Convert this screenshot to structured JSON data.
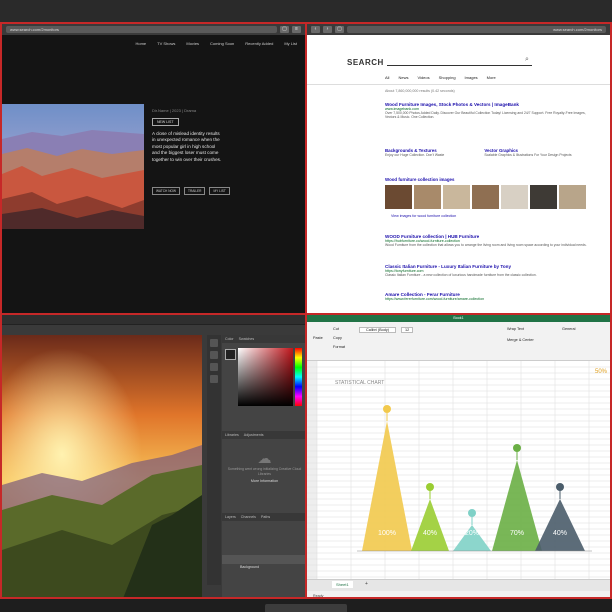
{
  "tl": {
    "url": "www.search.com/2monitors",
    "nav": [
      "Home",
      "TV Shows",
      "Movies",
      "Coming Soon",
      "Recently Added",
      "My List"
    ],
    "meta": "Dir.Name   |   2023   |   Drama",
    "tag": "NEW LIST",
    "text": "A close of mislead identity results in unexpected romance when the most popular girl in high school and the biggest loser must come together to win over their crushes.",
    "buttons": [
      "WATCH NOW",
      "TRAILER",
      "MY LIST"
    ]
  },
  "tr": {
    "url": "www.search.com/2monitors",
    "logo": "SEARCH",
    "tabs": [
      "All",
      "News",
      "Videos",
      "Shopping",
      "Images",
      "More"
    ],
    "count": "About 7,860,000,000 results (0.42 seconds)",
    "results": [
      {
        "title": "Wood Furniture Images, Stock Photos & Vectors | ImageBank",
        "url": "www.imagebank.com",
        "desc": "Over 7,500,000 Photos Added Daily. Discover Our Beautiful Collection Today! Licensing and 24/7 Support. Free Royalty-Free Images, Vectors & Music. One Collection."
      },
      {
        "title": "Wood furniture collection images",
        "url": "",
        "desc": ""
      },
      {
        "title": "WOOD Furniture collection | HUB Furniture",
        "url": "https://hubfurniture.co/wood-furniture-collection",
        "desc": "Wood Furniture from the collection that allows you to arrange the living room and living room space according to your individual needs."
      },
      {
        "title": "Classic Italian Furniture - Luxury Italian Furniture by Tony",
        "url": "https://tonyfurniture.com",
        "desc": "Classic Italian Furniture - a new collection of luxurious handmade furniture from the classic collection."
      },
      {
        "title": "Amare Collection - Ferar Furniture",
        "url": "https://www.fererfurniture.com/wood-furniture/amare-collection",
        "desc": ""
      }
    ],
    "cols": [
      {
        "title": "Backgrounds & Textures",
        "desc": "Enjoy our Huge Collection. Don't Waste"
      },
      {
        "title": "Vector Graphics",
        "desc": "Scalable Graphics & Illustrations For Your Design Projects"
      }
    ],
    "more": "View images for wood furniture collection"
  },
  "bl": {
    "panel_tabs": [
      "Color",
      "Swatches"
    ],
    "lib_tabs": [
      "Libraries",
      "Adjustments"
    ],
    "cloud_msg": "Something went wrong initializing Creative Cloud Libraries",
    "more_info": "More Information",
    "layer_tabs": [
      "Layers",
      "Channels",
      "Paths"
    ],
    "layer_name": "Background"
  },
  "br": {
    "title": "Book1",
    "ribbon": {
      "paste": "Paste",
      "cut": "Cut",
      "copy": "Copy",
      "format": "Format",
      "font": "Calibri (Body)",
      "size": "12",
      "wrap": "Wrap Text",
      "general": "General",
      "merge": "Merge & Center"
    },
    "sheet": "Sheet1",
    "status": "Ready"
  },
  "chart_data": {
    "type": "area",
    "title": "STATISTICAL CHART",
    "categories": [
      "A",
      "B",
      "C",
      "D",
      "E"
    ],
    "values": [
      100,
      40,
      20,
      70,
      40
    ],
    "value_labels": [
      "100%",
      "40%",
      "20%",
      "70%",
      "40%"
    ],
    "colors": [
      "#f2c94c",
      "#9acd32",
      "#7fd1c7",
      "#6aaf45",
      "#4a5c6a"
    ],
    "corner_label": "50%",
    "ylim": [
      0,
      100
    ]
  }
}
